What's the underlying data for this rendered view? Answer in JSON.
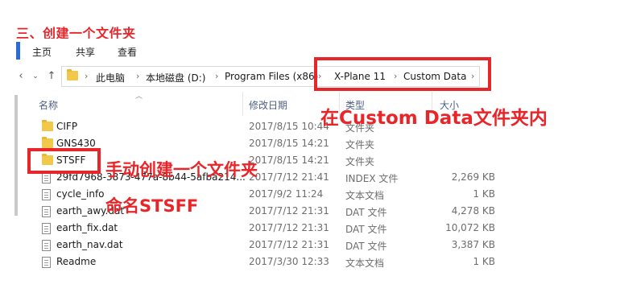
{
  "step_title": "三、创建一个文件夹",
  "ribbon": {
    "tabs": [
      "主页",
      "共享",
      "查看"
    ]
  },
  "address": {
    "crumbs": [
      "此电脑",
      "本地磁盘 (D:)",
      "Program Files (x86)",
      "X-Plane 11",
      "Custom Data"
    ]
  },
  "columns": {
    "name": "名称",
    "modified": "修改日期",
    "type": "类型",
    "size": "大小"
  },
  "files": [
    {
      "name": "CIFP",
      "date": "2017/8/15 10:44",
      "type": "文件夹",
      "size": "",
      "icon": "folder-icon"
    },
    {
      "name": "GNS430",
      "date": "2017/8/15 14:21",
      "type": "文件夹",
      "size": "",
      "icon": "folder-icon"
    },
    {
      "name": "STSFF",
      "date": "2017/8/15 14:21",
      "type": "文件夹",
      "size": "",
      "icon": "folder-icon"
    },
    {
      "name": "29fd7968-3873-477a-8b44-5afba214...",
      "date": "2017/7/12 21:41",
      "type": "INDEX 文件",
      "size": "2,269 KB",
      "icon": "file-icon"
    },
    {
      "name": "cycle_info",
      "date": "2017/9/2 11:24",
      "type": "文本文档",
      "size": "1 KB",
      "icon": "file-icon"
    },
    {
      "name": "earth_awy.dat",
      "date": "2017/7/12 21:31",
      "type": "DAT 文件",
      "size": "4,278 KB",
      "icon": "file-icon"
    },
    {
      "name": "earth_fix.dat",
      "date": "2017/7/12 21:31",
      "type": "DAT 文件",
      "size": "10,072 KB",
      "icon": "file-icon"
    },
    {
      "name": "earth_nav.dat",
      "date": "2017/7/12 21:31",
      "type": "DAT 文件",
      "size": "3,387 KB",
      "icon": "file-icon"
    },
    {
      "name": "Readme",
      "date": "2017/3/30 12:33",
      "type": "文本文档",
      "size": "1 KB",
      "icon": "file-icon"
    }
  ],
  "annotations": {
    "inside": "在Custom Data文件夹内",
    "manual_create": "手动创建一个文件夹",
    "rename": "命名STSFF"
  },
  "colors": {
    "annotation_red": "#e8262a",
    "folder_yellow": "#f2c84b",
    "ribbon_accent": "#2b6bd6"
  }
}
